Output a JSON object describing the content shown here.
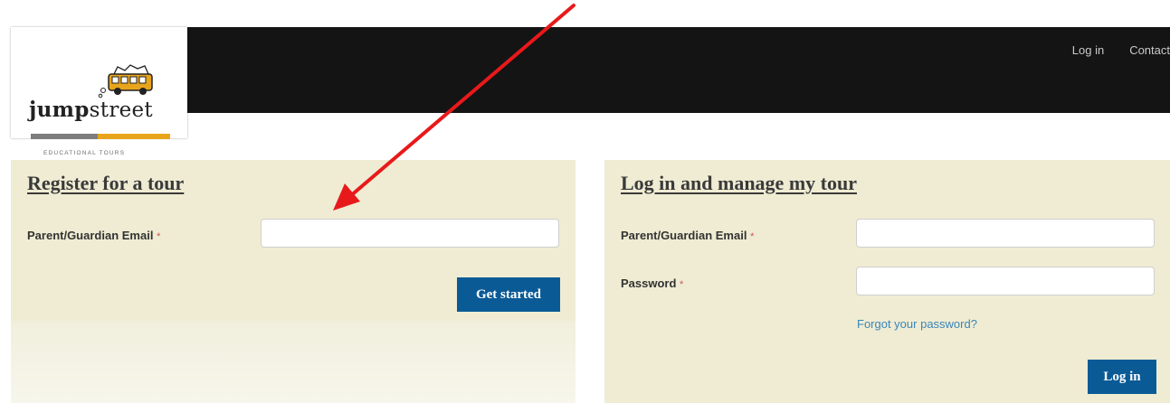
{
  "brand": {
    "name_bold": "jump",
    "name_rest": "street",
    "tagline": "EDUCATIONAL TOURS"
  },
  "nav": {
    "items": [
      "Log in",
      "Contact"
    ]
  },
  "register": {
    "title": "Register for a tour",
    "email_label": "Parent/Guardian Email",
    "required_mark": "*",
    "email_value": "",
    "button": "Get started"
  },
  "login": {
    "title": "Log in and manage my tour",
    "email_label": "Parent/Guardian Email",
    "password_label": "Password",
    "required_mark": "*",
    "email_value": "",
    "password_value": "",
    "forgot_link": "Forgot your password?",
    "button": "Log in"
  },
  "colors": {
    "panel_bg": "#efecd3",
    "button_bg": "#0a5a96",
    "header_bg": "#141414",
    "annotation_arrow": "#e8191b",
    "logo_gold": "#e8a51c"
  },
  "icons": {
    "logo": "school-bus-icon",
    "annotation": "red-arrow-icon"
  }
}
